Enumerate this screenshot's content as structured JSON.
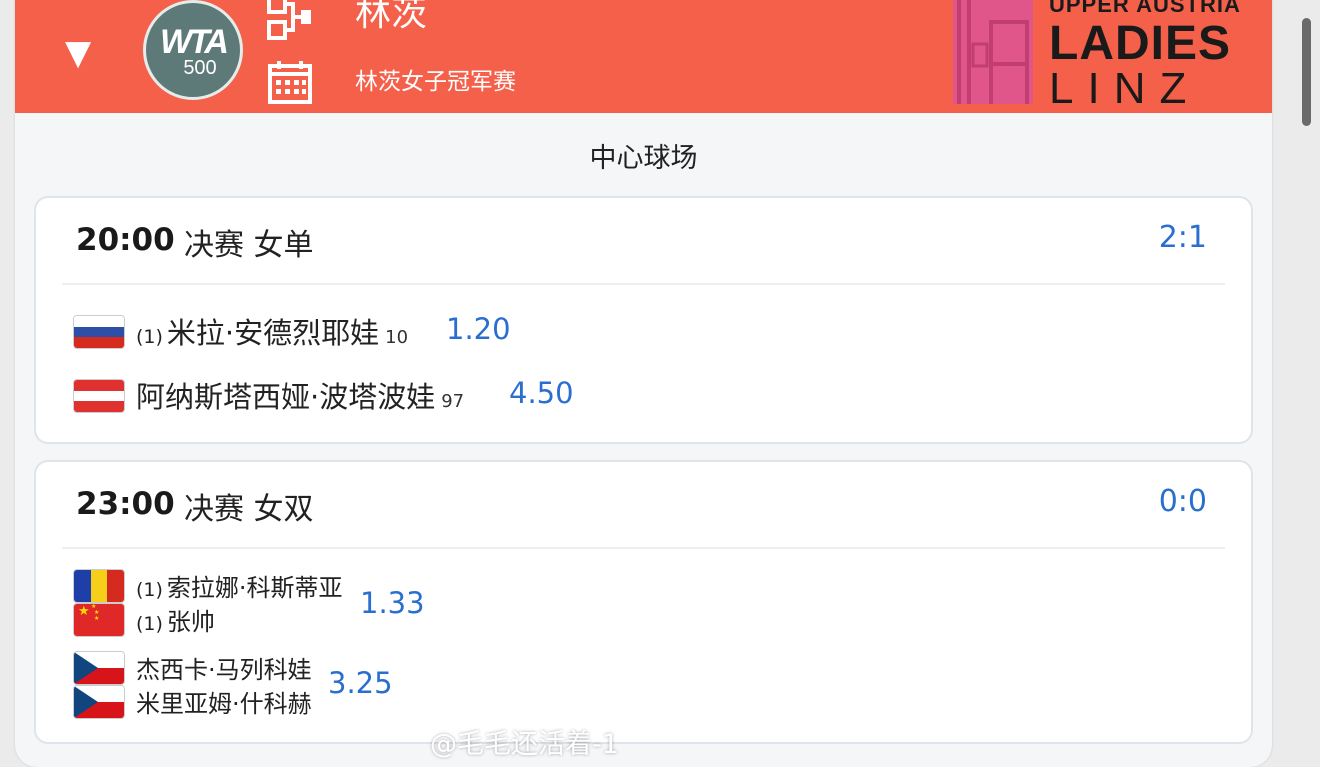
{
  "header": {
    "tournament_name": "林茨",
    "tournament_full": "林茨女子冠军赛",
    "wta_logo": {
      "text": "WTA",
      "tier": "500"
    },
    "brand": {
      "line1": "UPPER AUSTRIA",
      "line2": "LADIES",
      "line3": "LINZ"
    },
    "icons": [
      "chevron-down-icon",
      "bracket-icon",
      "calendar-icon"
    ],
    "background_color": "#f4604a"
  },
  "court": "中心球场",
  "matches": [
    {
      "time": "20:00",
      "round": "决赛 女单",
      "score": "2:1",
      "players": [
        {
          "seed": "(1)",
          "name": "米拉·安德烈耶娃",
          "rank": "10",
          "odds": "1.20",
          "flag": "russia"
        },
        {
          "seed": "",
          "name": "阿纳斯塔西娅·波塔波娃",
          "rank": "97",
          "odds": "4.50",
          "flag": "austria"
        }
      ]
    },
    {
      "time": "23:00",
      "round": "决赛 女双",
      "score": "0:0",
      "teams": [
        {
          "players": [
            {
              "seed": "(1)",
              "name": "索拉娜·科斯蒂亚",
              "flag": "romania"
            },
            {
              "seed": "(1)",
              "name": "张帅",
              "flag": "china"
            }
          ],
          "odds": "1.33"
        },
        {
          "players": [
            {
              "seed": "",
              "name": "杰西卡·马列科娃",
              "flag": "czech"
            },
            {
              "seed": "",
              "name": "米里亚姆·什科赫",
              "flag": "czech"
            }
          ],
          "odds": "3.25"
        }
      ]
    }
  ],
  "accent_color": "#2a6fcf",
  "watermark": "@毛毛还活着-1"
}
